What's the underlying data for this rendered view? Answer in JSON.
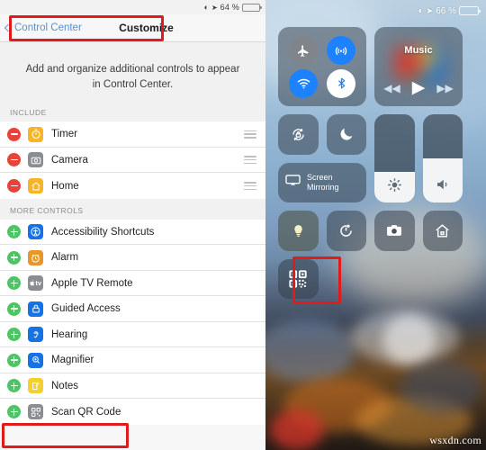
{
  "left": {
    "statusbar": {
      "wifi_icon": "wifi-icon",
      "location_icon": "location-arrow-icon",
      "battery_percent": "64 %",
      "battery_level": 64
    },
    "nav": {
      "back_label": "Control Center",
      "back_icon": "chevron-left-icon",
      "title": "Customize"
    },
    "intro": "Add and organize additional controls to appear in Control Center.",
    "sections": [
      {
        "header": "INCLUDE",
        "items": [
          {
            "label": "Timer",
            "action": "remove",
            "action_icon": "minus-circle-icon",
            "icon": "timer-icon",
            "glyph": "⏱",
            "icon_bg": "#f6b429",
            "handle_icon": "reorder-handle-icon"
          },
          {
            "label": "Camera",
            "action": "remove",
            "action_icon": "minus-circle-icon",
            "icon": "camera-icon",
            "glyph": "▣",
            "icon_bg": "#8a8e93",
            "handle_icon": "reorder-handle-icon"
          },
          {
            "label": "Home",
            "action": "remove",
            "action_icon": "minus-circle-icon",
            "icon": "home-icon",
            "glyph": "⌂",
            "icon_bg": "#f6b429",
            "handle_icon": "reorder-handle-icon"
          }
        ]
      },
      {
        "header": "MORE CONTROLS",
        "items": [
          {
            "label": "Accessibility Shortcuts",
            "action": "add",
            "action_icon": "plus-circle-icon",
            "icon": "accessibility-icon",
            "glyph": "Ⓙ",
            "icon_bg": "#1573e6"
          },
          {
            "label": "Alarm",
            "action": "add",
            "action_icon": "plus-circle-icon",
            "icon": "alarm-clock-icon",
            "glyph": "⏰",
            "icon_bg": "#e8962a"
          },
          {
            "label": "Apple TV Remote",
            "action": "add",
            "action_icon": "plus-circle-icon",
            "icon": "apple-tv-icon",
            "glyph": "tv",
            "icon_bg": "#8a8e93"
          },
          {
            "label": "Guided Access",
            "action": "add",
            "action_icon": "plus-circle-icon",
            "icon": "lock-icon",
            "glyph": "🔒",
            "icon_bg": "#1573e6"
          },
          {
            "label": "Hearing",
            "action": "add",
            "action_icon": "plus-circle-icon",
            "icon": "ear-icon",
            "glyph": "ʔ",
            "icon_bg": "#1573e6"
          },
          {
            "label": "Magnifier",
            "action": "add",
            "action_icon": "plus-circle-icon",
            "icon": "magnifier-icon",
            "glyph": "⌕",
            "icon_bg": "#1573e6"
          },
          {
            "label": "Notes",
            "action": "add",
            "action_icon": "plus-circle-icon",
            "icon": "notes-icon",
            "glyph": "✎",
            "icon_bg": "#f4cf2e"
          },
          {
            "label": "Scan QR Code",
            "action": "add",
            "action_icon": "plus-circle-icon",
            "icon": "qr-code-icon",
            "glyph": "▒",
            "icon_bg": "#8a8e93"
          }
        ]
      }
    ]
  },
  "right": {
    "statusbar": {
      "wifi_icon": "wifi-icon",
      "location_icon": "location-arrow-icon",
      "battery_percent": "66 %",
      "battery_level": 66
    },
    "connectivity": {
      "name": "connectivity-tile",
      "toggles": [
        {
          "name": "airplane-mode-toggle",
          "icon": "airplane-icon",
          "glyph": "✈",
          "state": "off"
        },
        {
          "name": "airdrop-toggle",
          "icon": "airdrop-icon",
          "glyph": "◉",
          "state": "on"
        },
        {
          "name": "wifi-toggle",
          "icon": "wifi-icon",
          "glyph": "◓",
          "state": "on"
        },
        {
          "name": "bluetooth-toggle",
          "icon": "bluetooth-icon",
          "glyph": "ᛩ",
          "state": "on"
        }
      ]
    },
    "music": {
      "title": "Music",
      "prev_icon": "rewind-icon",
      "prev_glyph": "◀◀",
      "play_icon": "play-icon",
      "play_glyph": "▶",
      "next_icon": "fastforward-icon",
      "next_glyph": "▶▶"
    },
    "small_tiles": [
      {
        "name": "rotation-lock-toggle",
        "icon": "rotation-lock-icon",
        "glyph": "🔒"
      },
      {
        "name": "do-not-disturb-toggle",
        "icon": "moon-icon",
        "glyph": "☽"
      }
    ],
    "screen_mirroring": {
      "label_line1": "Screen",
      "label_line2": "Mirroring",
      "icon": "airplay-icon"
    },
    "sliders": [
      {
        "name": "brightness-slider",
        "icon": "brightness-icon",
        "glyph": "☀",
        "value": 35
      },
      {
        "name": "volume-slider",
        "icon": "volume-icon",
        "glyph": "🔊",
        "value": 50
      }
    ],
    "app_tiles": [
      {
        "name": "flashlight-button",
        "icon": "flashlight-icon",
        "glyph": "🔔"
      },
      {
        "name": "timer-button",
        "icon": "timer-icon",
        "glyph": "⏱"
      },
      {
        "name": "camera-button",
        "icon": "camera-icon",
        "glyph": "📷"
      },
      {
        "name": "home-button",
        "icon": "home-icon",
        "glyph": "⌂"
      }
    ],
    "qr_tile": {
      "name": "scan-qr-code-button",
      "icon": "qr-code-icon"
    }
  },
  "annotations": {
    "highlight_color": "#e01b1b",
    "boxes": [
      {
        "name": "highlight-customize-navbar"
      },
      {
        "name": "highlight-scan-qr-code-row"
      },
      {
        "name": "highlight-qr-control-tile"
      }
    ]
  },
  "watermark": "wsxdn.com"
}
